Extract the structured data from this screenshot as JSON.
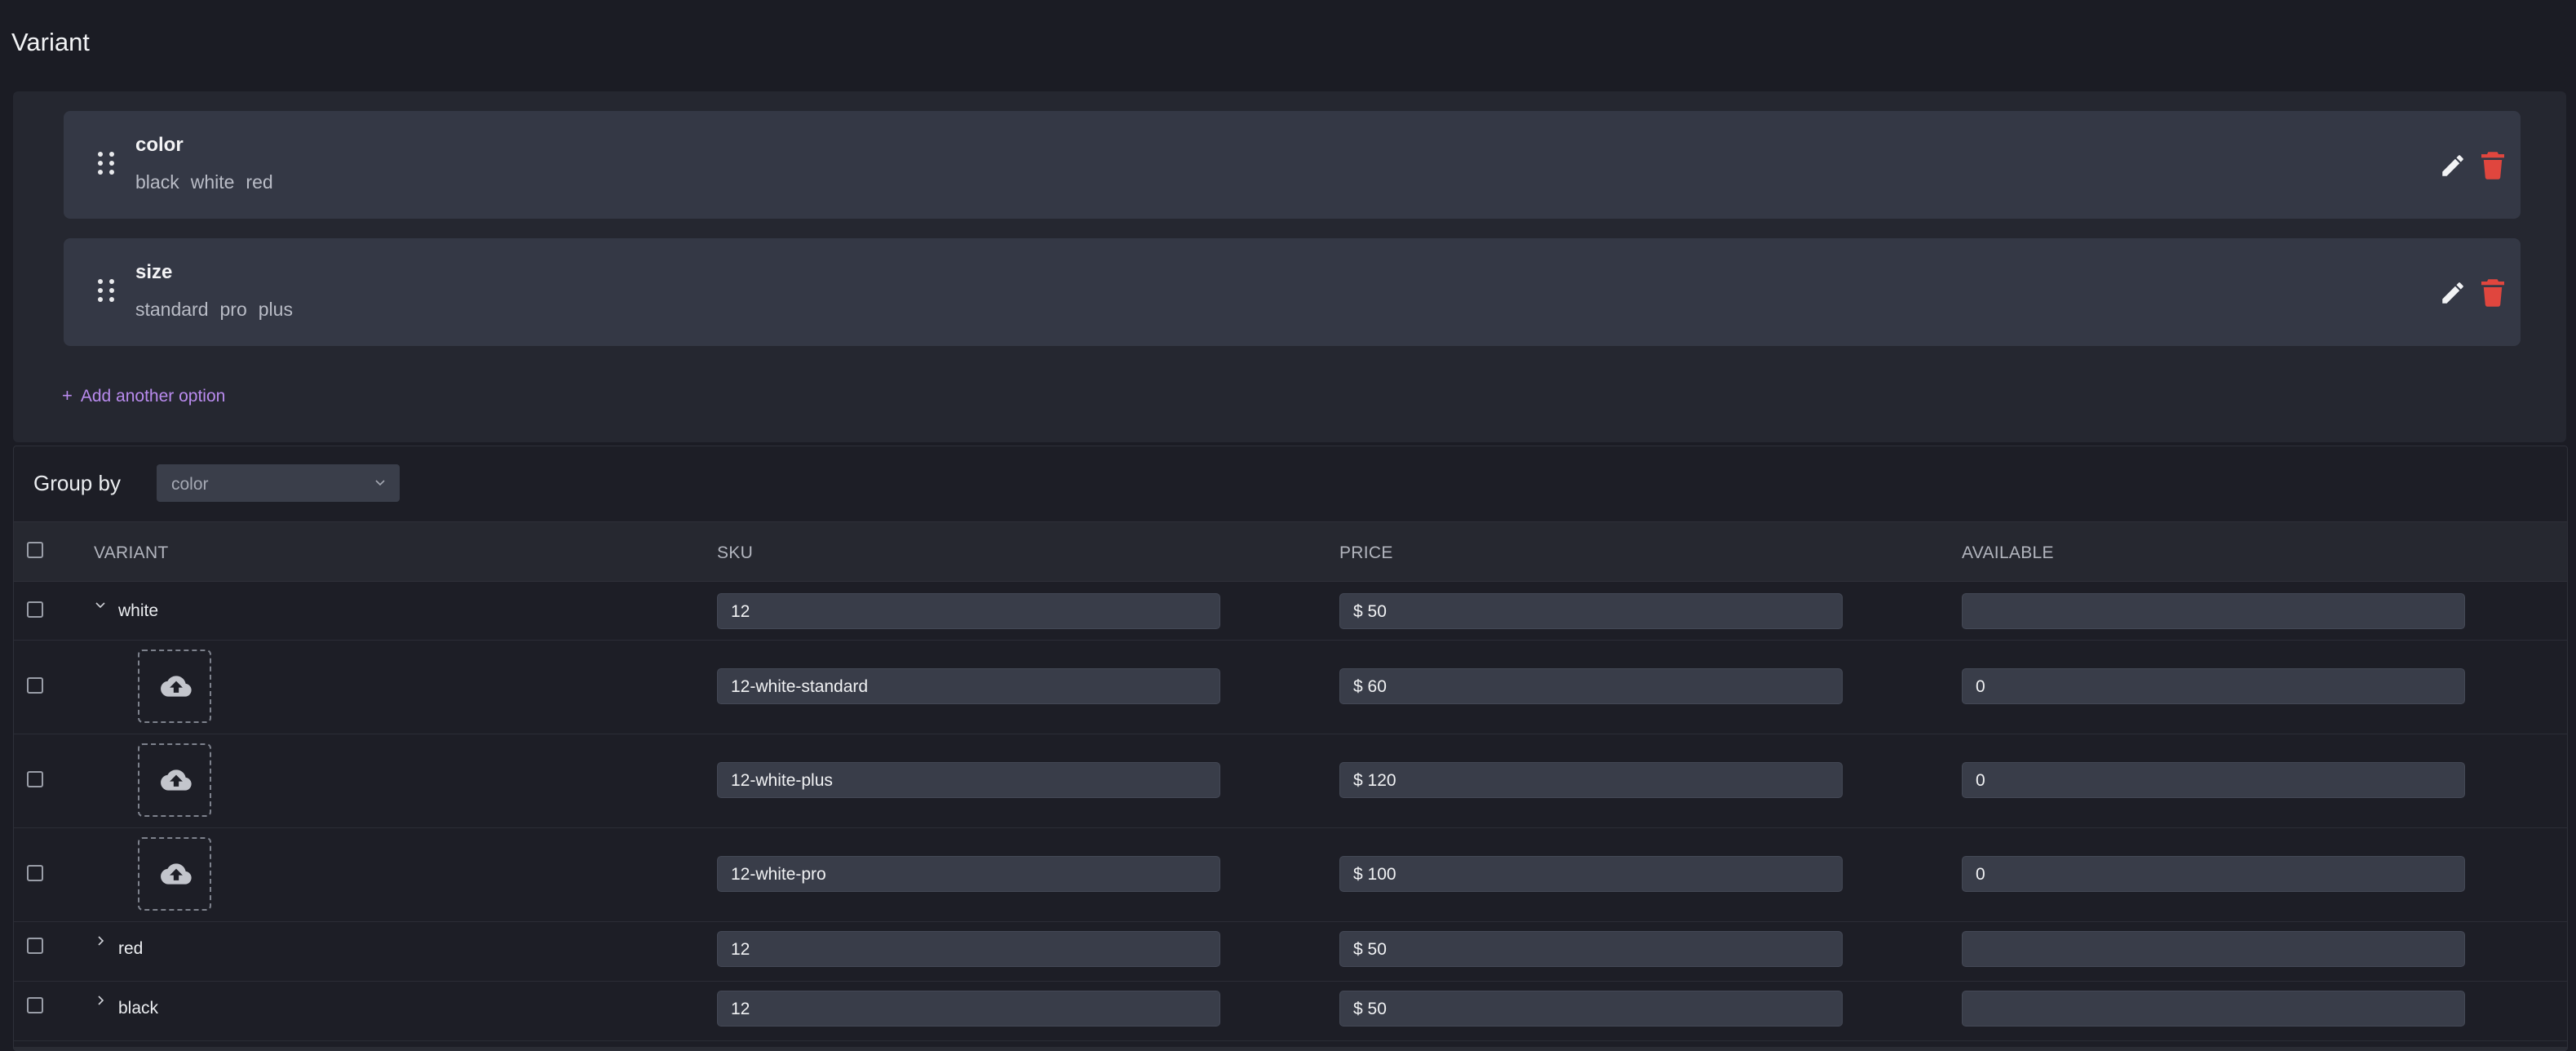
{
  "page": {
    "title": "Variant"
  },
  "options": [
    {
      "name": "color",
      "values": [
        "black",
        "white",
        "red"
      ]
    },
    {
      "name": "size",
      "values": [
        "standard",
        "pro",
        "plus"
      ]
    }
  ],
  "add_option": {
    "label": "Add another option"
  },
  "group_by": {
    "label": "Group by",
    "selected": "color"
  },
  "table": {
    "headers": {
      "variant": "VARIANT",
      "sku": "SKU",
      "price": "PRICE",
      "available": "AVAILABLE"
    },
    "rows": [
      {
        "type": "group",
        "label": "white",
        "expanded": true,
        "sku": "12",
        "price": "$ 50",
        "available": ""
      },
      {
        "type": "variant",
        "sku": "12-white-standard",
        "price": "$ 60",
        "available": "0"
      },
      {
        "type": "variant",
        "sku": "12-white-plus",
        "price": "$ 120",
        "available": "0"
      },
      {
        "type": "variant",
        "sku": "12-white-pro",
        "price": "$ 100",
        "available": "0"
      },
      {
        "type": "group",
        "label": "red",
        "expanded": false,
        "sku": "12",
        "price": "$ 50",
        "available": ""
      },
      {
        "type": "group",
        "label": "black",
        "expanded": false,
        "sku": "12",
        "price": "$ 50",
        "available": ""
      }
    ]
  },
  "colors": {
    "accent": "#b98bee",
    "danger": "#e0463e",
    "card": "#343845"
  },
  "icons": [
    "drag-handle-icon",
    "edit-pencil-icon",
    "trash-icon",
    "plus-icon",
    "chevron-down-icon",
    "chevron-right-icon",
    "upload-cloud-icon"
  ]
}
